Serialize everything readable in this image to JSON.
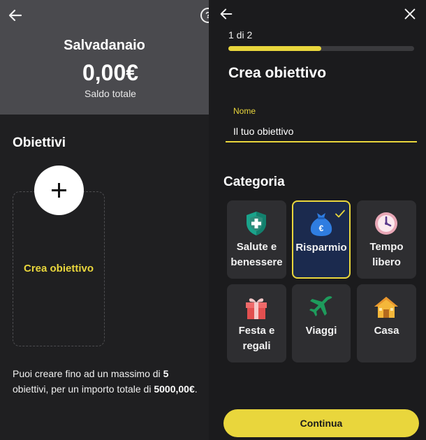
{
  "left": {
    "title": "Salvadanaio",
    "balance": "0,00€",
    "balance_label": "Saldo totale",
    "help_glyph": "?",
    "section_title": "Obiettivi",
    "create_goal_label": "Crea obiettivo",
    "info": {
      "part1": "Puoi creare fino ad un massimo di ",
      "max_goals": "5",
      "part2": " obiettivi, per un importo totale di ",
      "max_amount": "5000,00€",
      "part3": "."
    }
  },
  "right": {
    "step_text": "1 di 2",
    "progress_fraction": 0.5,
    "title": "Crea obiettivo",
    "name_label": "Nome",
    "name_value": "Il tuo obiettivo",
    "category_title": "Categoria",
    "categories": [
      {
        "label": "Salute e benessere",
        "icon": "health-shield-icon",
        "selected": false
      },
      {
        "label": "Risparmio",
        "icon": "money-bag-icon",
        "selected": true
      },
      {
        "label": "Tempo libero",
        "icon": "clock-icon",
        "selected": false
      },
      {
        "label": "Festa e regali",
        "icon": "gift-icon",
        "selected": false
      },
      {
        "label": "Viaggi",
        "icon": "airplane-icon",
        "selected": false
      },
      {
        "label": "Casa",
        "icon": "house-icon",
        "selected": false
      }
    ],
    "continue_label": "Continua"
  },
  "colors": {
    "accent": "#e9d63c",
    "background": "#1f1f21",
    "header": "#4a4a4e",
    "tile": "#2e2e31",
    "tile_selected": "#1b2a4e"
  }
}
